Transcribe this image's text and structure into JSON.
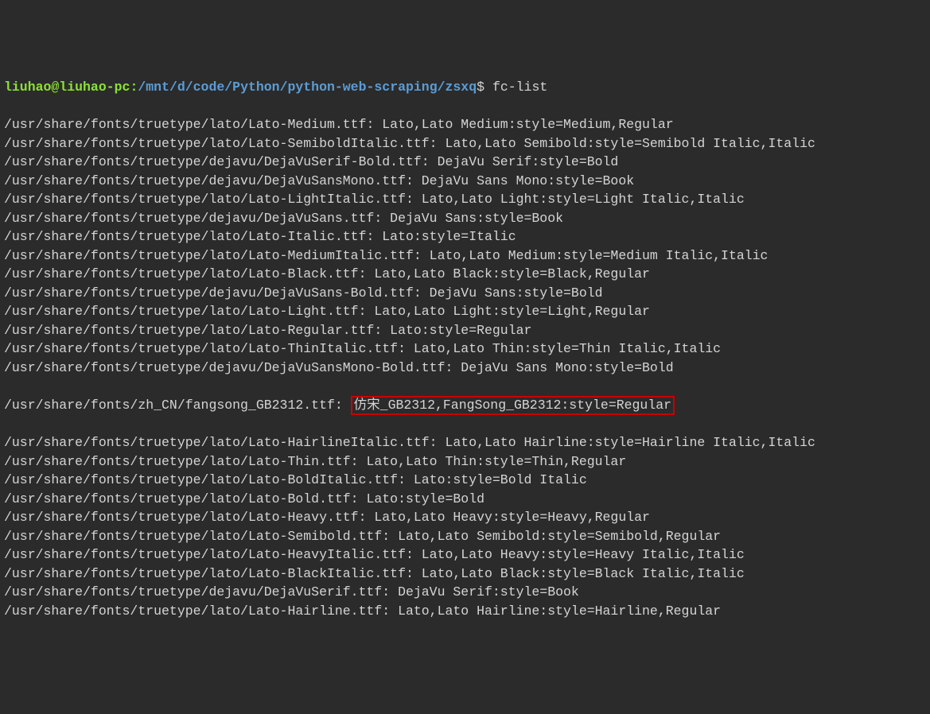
{
  "prompt": {
    "user": "liuhao@liuhao-pc",
    "separator": ":",
    "path": "/mnt/d/code/Python/python-web-scraping/zsxq",
    "dollar": "$",
    "command": "fc-list"
  },
  "output": [
    "/usr/share/fonts/truetype/lato/Lato-Medium.ttf: Lato,Lato Medium:style=Medium,Regular",
    "/usr/share/fonts/truetype/lato/Lato-SemiboldItalic.ttf: Lato,Lato Semibold:style=Semibold Italic,Italic",
    "/usr/share/fonts/truetype/dejavu/DejaVuSerif-Bold.ttf: DejaVu Serif:style=Bold",
    "/usr/share/fonts/truetype/dejavu/DejaVuSansMono.ttf: DejaVu Sans Mono:style=Book",
    "/usr/share/fonts/truetype/lato/Lato-LightItalic.ttf: Lato,Lato Light:style=Light Italic,Italic",
    "/usr/share/fonts/truetype/dejavu/DejaVuSans.ttf: DejaVu Sans:style=Book",
    "/usr/share/fonts/truetype/lato/Lato-Italic.ttf: Lato:style=Italic",
    "/usr/share/fonts/truetype/lato/Lato-MediumItalic.ttf: Lato,Lato Medium:style=Medium Italic,Italic",
    "/usr/share/fonts/truetype/lato/Lato-Black.ttf: Lato,Lato Black:style=Black,Regular",
    "/usr/share/fonts/truetype/dejavu/DejaVuSans-Bold.ttf: DejaVu Sans:style=Bold",
    "/usr/share/fonts/truetype/lato/Lato-Light.ttf: Lato,Lato Light:style=Light,Regular",
    "/usr/share/fonts/truetype/lato/Lato-Regular.ttf: Lato:style=Regular",
    "/usr/share/fonts/truetype/lato/Lato-ThinItalic.ttf: Lato,Lato Thin:style=Thin Italic,Italic",
    "/usr/share/fonts/truetype/dejavu/DejaVuSansMono-Bold.ttf: DejaVu Sans Mono:style=Bold"
  ],
  "highlighted_line": {
    "prefix": "/usr/share/fonts/zh_CN/fangsong_GB2312.ttf: ",
    "highlighted": "仿宋_GB2312,FangSong_GB2312:style=Regular"
  },
  "output_after": [
    "/usr/share/fonts/truetype/lato/Lato-HairlineItalic.ttf: Lato,Lato Hairline:style=Hairline Italic,Italic",
    "/usr/share/fonts/truetype/lato/Lato-Thin.ttf: Lato,Lato Thin:style=Thin,Regular",
    "/usr/share/fonts/truetype/lato/Lato-BoldItalic.ttf: Lato:style=Bold Italic",
    "/usr/share/fonts/truetype/lato/Lato-Bold.ttf: Lato:style=Bold",
    "/usr/share/fonts/truetype/lato/Lato-Heavy.ttf: Lato,Lato Heavy:style=Heavy,Regular",
    "/usr/share/fonts/truetype/lato/Lato-Semibold.ttf: Lato,Lato Semibold:style=Semibold,Regular",
    "/usr/share/fonts/truetype/lato/Lato-HeavyItalic.ttf: Lato,Lato Heavy:style=Heavy Italic,Italic",
    "/usr/share/fonts/truetype/lato/Lato-BlackItalic.ttf: Lato,Lato Black:style=Black Italic,Italic",
    "/usr/share/fonts/truetype/dejavu/DejaVuSerif.ttf: DejaVu Serif:style=Book",
    "/usr/share/fonts/truetype/lato/Lato-Hairline.ttf: Lato,Lato Hairline:style=Hairline,Regular"
  ]
}
